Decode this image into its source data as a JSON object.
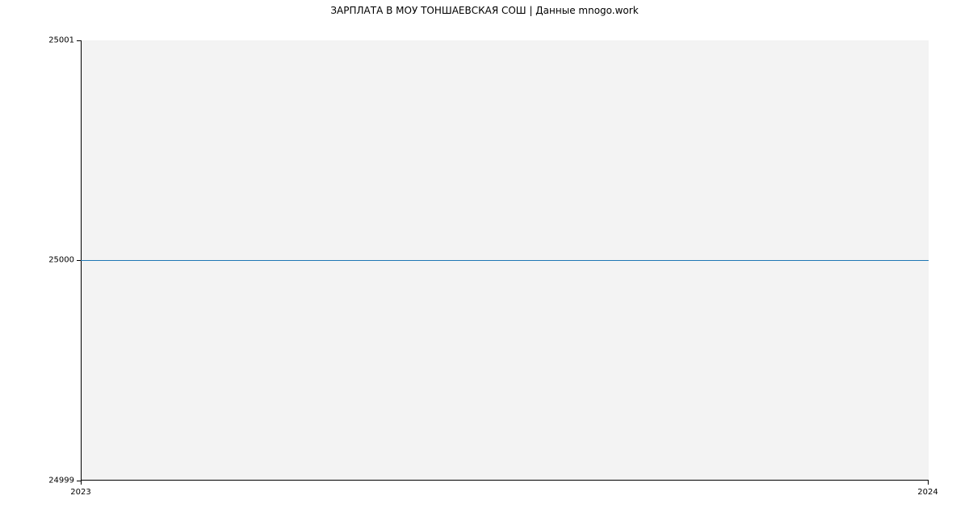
{
  "chart_data": {
    "type": "line",
    "title": "ЗАРПЛАТА В МОУ ТОНШАЕВСКАЯ СОШ | Данные mnogo.work",
    "xlabel": "",
    "ylabel": "",
    "x": [
      2023,
      2024
    ],
    "series": [
      {
        "name": "salary",
        "values": [
          25000,
          25000
        ],
        "color": "#1f77b4"
      }
    ],
    "xticks": [
      "2023",
      "2024"
    ],
    "yticks": [
      "24999",
      "25000",
      "25001"
    ],
    "ylim": [
      24999,
      25001
    ],
    "xlim": [
      2023,
      2024
    ],
    "grid": false,
    "background": "#f3f3f3"
  }
}
